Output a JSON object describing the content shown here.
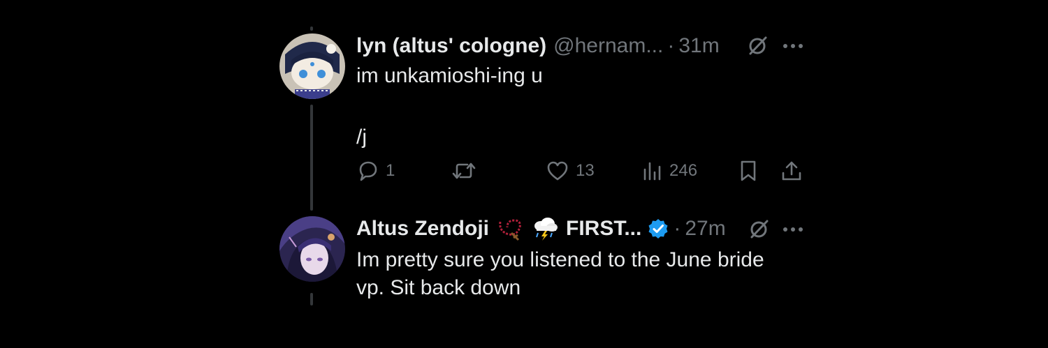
{
  "colors": {
    "background": "#000000",
    "text": "#e7e9ea",
    "muted": "#71767b",
    "verified": "#1d9bf0",
    "thread_line": "#333639"
  },
  "posts": [
    {
      "display_name": "lyn (altus' cologne)",
      "handle": "@hernam...",
      "separator": "·",
      "time": "31m",
      "text_lines": [
        "im unkamioshi-ing u",
        "",
        "/j"
      ],
      "icons": [
        "grok-icon",
        "more-icon"
      ],
      "actions": {
        "reply": {
          "icon": "reply-icon",
          "count": "1"
        },
        "repost": {
          "icon": "repost-icon",
          "count": ""
        },
        "like": {
          "icon": "heart-icon",
          "count": "13"
        },
        "views": {
          "icon": "views-icon",
          "count": "246"
        },
        "bookmark": {
          "icon": "bookmark-icon"
        },
        "share": {
          "icon": "share-icon"
        }
      }
    },
    {
      "display_name": "Altus Zendoji",
      "name_suffix": "FIRST...",
      "name_emojis": [
        "rosary-emoji",
        "cloud-with-lightning-and-rain-emoji"
      ],
      "verified": true,
      "separator": "·",
      "time": "27m",
      "text_lines": [
        "Im pretty sure you listened to the June bride",
        "vp. Sit back down"
      ],
      "icons": [
        "verified-badge-icon",
        "grok-icon",
        "more-icon"
      ]
    }
  ]
}
